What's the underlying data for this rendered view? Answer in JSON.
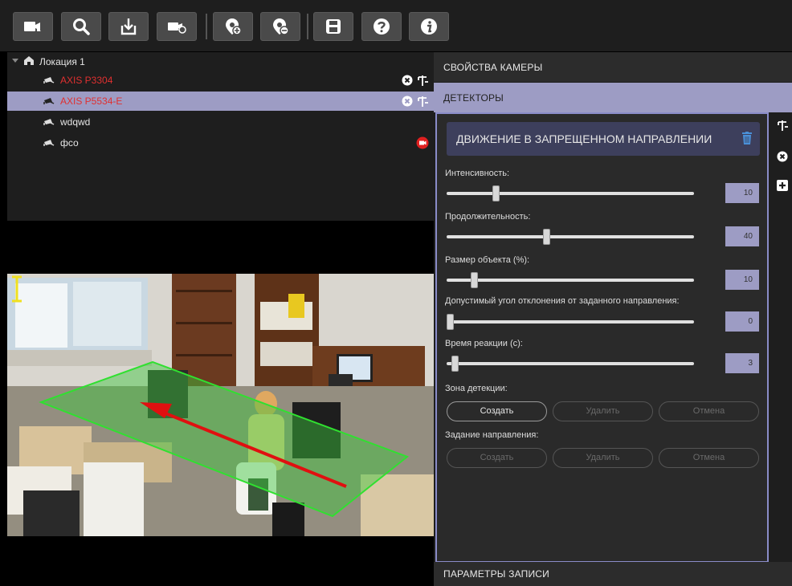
{
  "toolbar": {
    "icons": [
      "add-camera-icon",
      "search-icon",
      "import-icon",
      "camera-settings-icon",
      "add-location-icon",
      "remove-location-icon",
      "save-icon",
      "help-icon",
      "info-icon"
    ]
  },
  "tree": {
    "root_label": "Локация 1",
    "items": [
      {
        "label": "AXIS P3304",
        "color": "#e03030"
      },
      {
        "label": "AXIS P5534-E",
        "color": "#e03030"
      },
      {
        "label": "wdqwd",
        "color": "#e6e6e6"
      },
      {
        "label": "фсо",
        "color": "#e6e6e6"
      }
    ]
  },
  "panel": {
    "camera_props": "СВОЙСТВА КАМЕРЫ",
    "detectors": "ДЕТЕКТОРЫ",
    "record_params": "ПАРАМЕТРЫ ЗАПИСИ"
  },
  "detector": {
    "title": "ДВИЖЕНИЕ В ЗАПРЕЩЕННОМ НАПРАВЛЕНИИ",
    "params": [
      {
        "label": "Интенсивность:",
        "value": "10",
        "fraction": 0.19
      },
      {
        "label": "Продолжительность:",
        "value": "40",
        "fraction": 0.4
      },
      {
        "label": "Размер объекта (%):",
        "value": "10",
        "fraction": 0.1
      },
      {
        "label": "Допустимый угол отклонения от заданного направления:",
        "value": "0",
        "fraction": 0.0
      },
      {
        "label": "Время реакции (с):",
        "value": "3",
        "fraction": 0.02
      }
    ],
    "zone_label": "Зона детекции:",
    "direction_label": "Задание направления:",
    "zone_buttons": {
      "create": "Создать",
      "delete": "Удалить",
      "cancel": "Отмена"
    },
    "direction_buttons": {
      "create": "Создать",
      "delete": "Удалить",
      "cancel": "Отмена"
    }
  },
  "colors": {
    "accent": "#9d9cc4",
    "title_bg": "#3d3f5c",
    "zone": "#30d030",
    "direction": "#e01010",
    "record_indicator": "#e02020"
  }
}
